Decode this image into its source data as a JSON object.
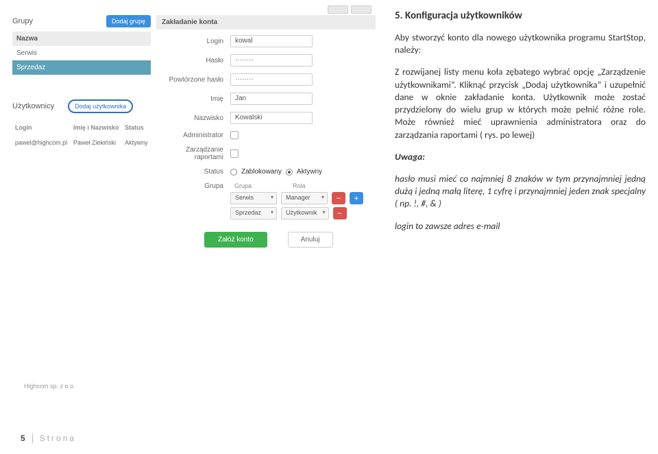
{
  "left": {
    "groups_label": "Grupy",
    "add_group_btn": "Dodaj grupę",
    "group_header": "Nazwa",
    "groups": [
      "Serwis",
      "Sprzedaz"
    ],
    "users_label": "Użytkownicy",
    "add_user_btn": "Dodaj użytkownika",
    "user_cols": {
      "login": "Login",
      "name": "Imię i Nazwisko",
      "status": "Status"
    },
    "user_row": {
      "login": "pawel@highcom.pl",
      "name": "Paweł Ziekiński",
      "status": "Aktywny"
    }
  },
  "form": {
    "title": "Zakładanie konta",
    "login_lbl": "Login",
    "login_val": "kowal",
    "pass_lbl": "Hasło",
    "pass_val": "········",
    "pass2_lbl": "Powtórzone hasło",
    "pass2_val": "········",
    "fname_lbl": "Imię",
    "fname_val": "Jan",
    "lname_lbl": "Nazwisko",
    "lname_val": "Kowalski",
    "admin_lbl": "Administrator",
    "reports_lbl": "Zarządzanie raportami",
    "status_lbl": "Status",
    "status_blocked": "Zablokowany",
    "status_active": "Aktywny",
    "group_lbl": "Grupa",
    "gcols": {
      "group": "Grupa",
      "role": "Rola"
    },
    "rows": [
      {
        "group": "Serwis",
        "role": "Manager"
      },
      {
        "group": "Sprzedaz",
        "role": "Użytkownik"
      }
    ],
    "create_btn": "Załóż konto",
    "cancel_btn": "Anuluj"
  },
  "doc": {
    "heading": "5.   Konfiguracja użytkowników",
    "p1": "Aby stworzyć konto dla nowego użytkownika programu StartStop, należy:",
    "p2": "Z rozwijanej listy menu koła zębatego wybrać opcję „Zarządzenie użytkownikami”. Kliknąć przycisk „Dodaj użytkownika” i uzupełnić dane w oknie zakładanie konta. Użytkownik może zostać przydzielony do wielu grup w których może pełnić różne role. Może również mieć uprawnienia administratora oraz do zarządzania raportami ( rys. po lewej)",
    "note_lbl": "Uwaga:",
    "note1": "hasło musi mieć co najmniej 8 znaków w tym przynajmniej jedną dużą i jedną małą literę, 1 cyfrę i przynajmniej jeden znak specjalny ( np. !, #, & )",
    "note2": "login to zawsze adres e-mail"
  },
  "footer": {
    "company": "Highcom sp. z o.o.",
    "page_no": "5",
    "page_txt": "Strona"
  }
}
